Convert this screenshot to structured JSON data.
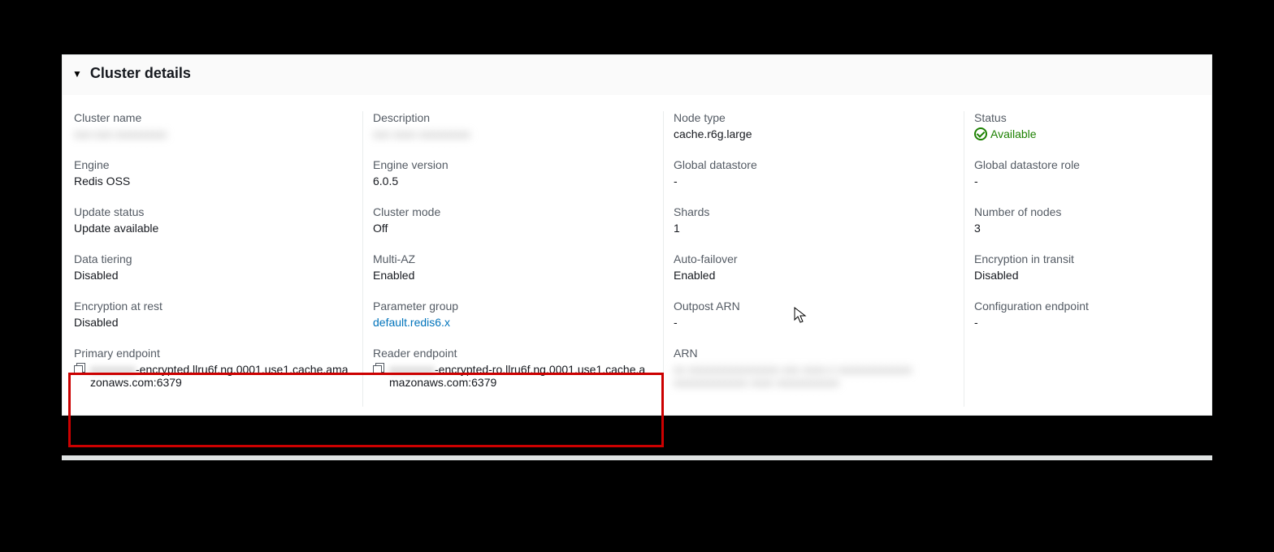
{
  "header": {
    "title": "Cluster details"
  },
  "col1": {
    "cluster_name_label": "Cluster name",
    "cluster_name_value": "xxx-xxx-xxxxxxxxx",
    "engine_label": "Engine",
    "engine_value": "Redis OSS",
    "update_status_label": "Update status",
    "update_status_value": "Update available",
    "data_tiering_label": "Data tiering",
    "data_tiering_value": "Disabled",
    "encryption_at_rest_label": "Encryption at rest",
    "encryption_at_rest_value": "Disabled",
    "primary_endpoint_label": "Primary endpoint",
    "primary_endpoint_blurred": "xxxxxxxx",
    "primary_endpoint_value": "-encrypted.llru6f.ng.0001.use1.cache.amazonaws.com:6379"
  },
  "col2": {
    "description_label": "Description",
    "description_value": "xxx xxxx xxxxxxxxx",
    "engine_version_label": "Engine version",
    "engine_version_value": "6.0.5",
    "cluster_mode_label": "Cluster mode",
    "cluster_mode_value": "Off",
    "multi_az_label": "Multi-AZ",
    "multi_az_value": "Enabled",
    "parameter_group_label": "Parameter group",
    "parameter_group_value": "default.redis6.x",
    "reader_endpoint_label": "Reader endpoint",
    "reader_endpoint_blurred": "xxxxxxxx",
    "reader_endpoint_value": "-encrypted-ro.llru6f.ng.0001.use1.cache.amazonaws.com:6379"
  },
  "col3": {
    "node_type_label": "Node type",
    "node_type_value": "cache.r6g.large",
    "global_datastore_label": "Global datastore",
    "global_datastore_value": "-",
    "shards_label": "Shards",
    "shards_value": "1",
    "auto_failover_label": "Auto-failover",
    "auto_failover_value": "Enabled",
    "outpost_arn_label": "Outpost ARN",
    "outpost_arn_value": "-",
    "arn_label": "ARN",
    "arn_value": "xx xxxxxxxxxxxxxxxx xxx xxxx-x xxxxxxxxxxxxx xxxxxxxxxxxxx xxxx xxxxxxxxxxx"
  },
  "col4": {
    "status_label": "Status",
    "status_value": "Available",
    "global_datastore_role_label": "Global datastore role",
    "global_datastore_role_value": "-",
    "number_of_nodes_label": "Number of nodes",
    "number_of_nodes_value": "3",
    "encryption_in_transit_label": "Encryption in transit",
    "encryption_in_transit_value": "Disabled",
    "configuration_endpoint_label": "Configuration endpoint",
    "configuration_endpoint_value": "-"
  }
}
